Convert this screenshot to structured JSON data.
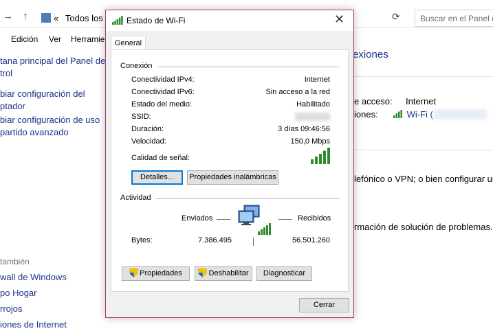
{
  "background": {
    "address_bar": {
      "back_arrow": "«",
      "path_text": "Todos los e"
    },
    "search": {
      "placeholder": "Buscar en el Panel d"
    },
    "menu": [
      "Edición",
      "Ver",
      "Herramie"
    ],
    "sidebar": {
      "links": [
        "tana principal del Panel de",
        "trol",
        "biar configuración del",
        "ptador",
        "biar configuración de uso",
        "partido avanzado"
      ],
      "see_also_heading": "también",
      "see_also": [
        "wall de Windows",
        "po Hogar",
        "rrojos",
        "iones de Internet"
      ]
    },
    "main": {
      "title": "exiones",
      "access_label": "e acceso:",
      "access_value": "Internet",
      "connections_label": "iones:",
      "connection_link": "Wi-Fi (",
      "vpn_text": "lefónico o VPN; o bien configurar un",
      "troubleshoot_text": "rmación de solución de problemas."
    }
  },
  "dialog": {
    "title": "Estado de Wi-Fi",
    "tab_label": "General",
    "connection": {
      "heading": "Conexión",
      "rows": [
        {
          "label": "Conectividad IPv4:",
          "value": "Internet"
        },
        {
          "label": "Conectividad IPv6:",
          "value": "Sin acceso a la red"
        },
        {
          "label": "Estado del medio:",
          "value": "Habilitado"
        },
        {
          "label": "SSID:",
          "value": ""
        },
        {
          "label": "Duración:",
          "value": "3 días 09:46:56"
        },
        {
          "label": "Velocidad:",
          "value": "150,0 Mbps"
        }
      ],
      "signal_label": "Calidad de señal:",
      "signal_bars": 5,
      "details_button": "Detalles...",
      "wireless_props_button": "Propiedades inalámbricas"
    },
    "activity": {
      "heading": "Actividad",
      "sent_label": "Enviados",
      "received_label": "Recibidos",
      "bytes_label": "Bytes:",
      "bytes_sent": "7.386.495",
      "bytes_received": "56.501.260"
    },
    "buttons": {
      "properties": "Propiedades",
      "disable": "Deshabilitar",
      "diagnose": "Diagnosticar",
      "close": "Cerrar"
    },
    "colors": {
      "border": "#b5326d",
      "signal": "#2e8b2e",
      "focus": "#0078d7"
    }
  }
}
